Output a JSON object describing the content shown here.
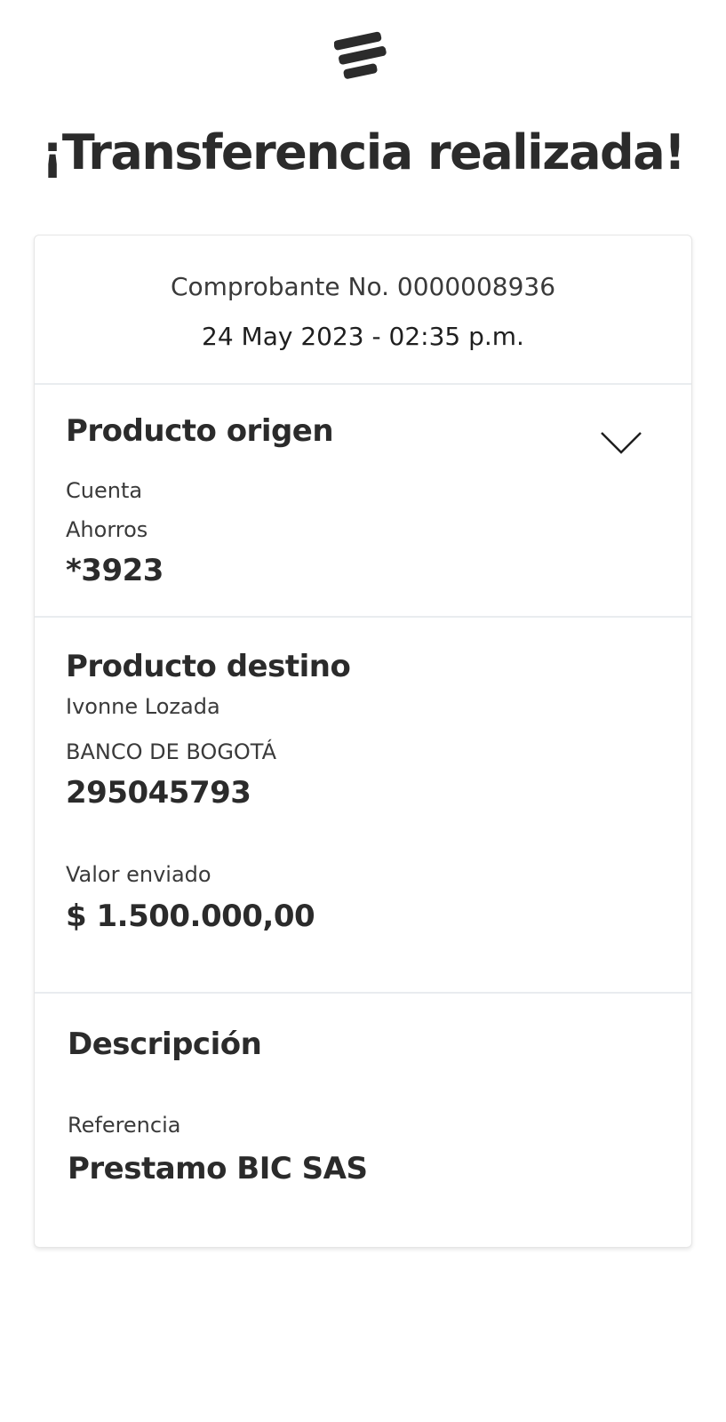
{
  "header": {
    "logo_icon": "bancolombia-logo-icon",
    "title": "¡Transferencia realizada!"
  },
  "receipt": {
    "number": "Comprobante No. 0000008936",
    "date": "24 May 2023 - 02:35 p.m."
  },
  "origin": {
    "title": "Producto origen",
    "account_type_line1": "Cuenta",
    "account_type_line2": "Ahorros",
    "account_number": "*3923",
    "toggle_icon": "chevron-down-icon"
  },
  "destination": {
    "title": "Producto destino",
    "recipient_name": "Ivonne Lozada",
    "bank_name": "BANCO DE BOGOTÁ",
    "account_number": "295045793",
    "amount_label": "Valor enviado",
    "amount_value": "$ 1.500.000,00"
  },
  "description": {
    "title": "Descripción",
    "reference_label": "Referencia",
    "reference_value": "Prestamo BIC SAS"
  },
  "colors": {
    "text_primary": "#2b2b2b",
    "divider": "#e9ecef",
    "background": "#ffffff"
  }
}
